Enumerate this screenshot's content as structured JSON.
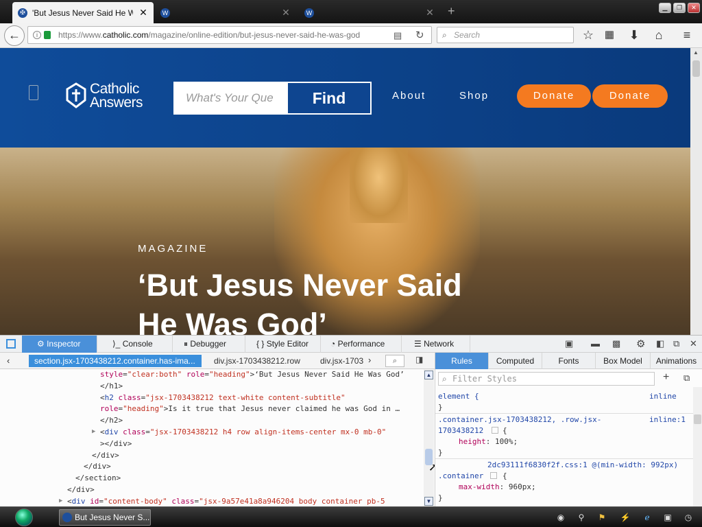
{
  "browser": {
    "tabs": [
      {
        "title": "'But Jesus Never Said He W...",
        "active": true
      },
      {
        "title": "",
        "active": false
      },
      {
        "title": "",
        "active": false
      }
    ],
    "url_prefix": "https://www.",
    "url_domain": "catholic.com",
    "url_path": "/magazine/online-edition/but-jesus-never-said-he-was-god",
    "search_placeholder": "Search"
  },
  "site": {
    "logo_line1": "Catholic",
    "logo_line2": "Answers",
    "search_placeholder": "What's Your Que",
    "find_label": "Find",
    "nav": [
      "About",
      "Shop"
    ],
    "donate_labels": [
      "Donate",
      "Donate"
    ],
    "kicker": "MAGAZINE",
    "headline_line1": "‘But Jesus Never Said",
    "headline_line2": "He Was God’"
  },
  "devtools": {
    "tabs": [
      "Inspector",
      "Console",
      "Debugger",
      "Style Editor",
      "Performance",
      "Network"
    ],
    "breadcrumbs": [
      "section.jsx-1703438212.container.has-ima...",
      "div.jsx-1703438212.row",
      "div.jsx-1703"
    ],
    "markup_lines": [
      {
        "indent": 146,
        "parts": [
          [
            "at",
            "style"
          ],
          [
            "",
            "="
          ],
          [
            "vl",
            "\"clear:both\""
          ],
          [
            "",
            " "
          ],
          [
            "at",
            "role"
          ],
          [
            "",
            "="
          ],
          [
            "vl",
            "\"heading\""
          ],
          [
            "",
            ">‘But Jesus Never Said He Was God’"
          ]
        ]
      },
      {
        "indent": 146,
        "parts": [
          [
            "",
            "</h1>"
          ]
        ]
      },
      {
        "indent": 146,
        "parts": [
          [
            "",
            "<"
          ],
          [
            "tg",
            "h2"
          ],
          [
            "",
            " "
          ],
          [
            "at",
            "class"
          ],
          [
            "",
            "="
          ],
          [
            "vl",
            "\"jsx-1703438212 text-white content-subtitle\""
          ]
        ]
      },
      {
        "indent": 146,
        "parts": [
          [
            "at",
            "role"
          ],
          [
            "",
            "="
          ],
          [
            "vl",
            "\"heading\""
          ],
          [
            "",
            ">Is it true that Jesus never claimed he was God in …"
          ]
        ]
      },
      {
        "indent": 146,
        "parts": [
          [
            "",
            "</h2>"
          ]
        ]
      },
      {
        "indent": 146,
        "parts": [
          [
            "",
            "<"
          ],
          [
            "tg",
            "div"
          ],
          [
            "",
            " "
          ],
          [
            "at",
            "class"
          ],
          [
            "",
            "="
          ],
          [
            "vl",
            "\"jsx-1703438212 h4 row align-items-center mx-0 mb-0\""
          ]
        ]
      },
      {
        "indent": 146,
        "parts": [
          [
            "",
            "></div>"
          ]
        ]
      },
      {
        "indent": 134,
        "parts": [
          [
            "",
            "</div>"
          ]
        ]
      },
      {
        "indent": 122,
        "parts": [
          [
            "",
            "</div>"
          ]
        ]
      },
      {
        "indent": 110,
        "parts": [
          [
            "",
            "</section>"
          ]
        ]
      },
      {
        "indent": 98,
        "parts": [
          [
            "",
            "</div>"
          ]
        ]
      },
      {
        "indent": 98,
        "parts": [
          [
            "",
            "<"
          ],
          [
            "tg",
            "div"
          ],
          [
            "",
            " "
          ],
          [
            "at",
            "id"
          ],
          [
            "",
            "="
          ],
          [
            "vl",
            "\"content-body\""
          ],
          [
            "",
            " "
          ],
          [
            "at",
            "class"
          ],
          [
            "",
            "="
          ],
          [
            "vl",
            "\"jsx-9a57e41a8a946204 body container pb-5"
          ]
        ]
      }
    ],
    "rule_tabs": [
      "Rules",
      "Computed",
      "Fonts",
      "Box Model",
      "Animations"
    ],
    "filter_placeholder": "Filter Styles",
    "rules": {
      "r1_selector": "element {",
      "r1_source": "inline",
      "r1_close": "}",
      "r2_selector_a": ".container.jsx-1703438212, .row.jsx-",
      "r2_source": "inline:1",
      "r2_selector_b": "1703438212",
      "r2_brace": "{",
      "r2_prop": "height",
      "r2_value": "100%;",
      "r2_close": "}",
      "r3_source": "2dc93111f6830f2f.css:1 @(min-width: 992px)",
      "r3_selector": ".container",
      "r3_brace": "{",
      "r3_prop": "max-width",
      "r3_value": "960px;",
      "r3_close": "}"
    }
  },
  "taskbar": {
    "item_label": "But Jesus Never S..."
  },
  "colors": {
    "header_blue": "#0f4c9a",
    "donate_orange": "#f47a20",
    "devtools_accent": "#4a90d9"
  }
}
